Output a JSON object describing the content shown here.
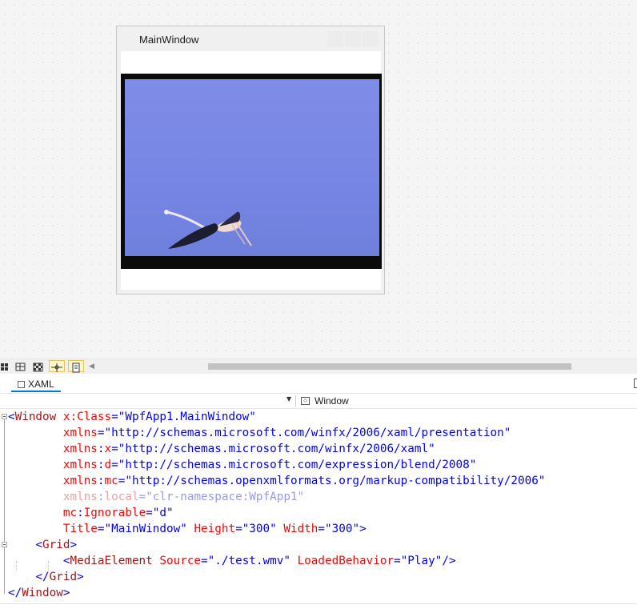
{
  "preview": {
    "window_title": "MainWindow"
  },
  "tabs": {
    "xaml_label": "XAML"
  },
  "nav": {
    "element_label": "Window"
  },
  "colors": {
    "xaml_tag": "#a31515",
    "xaml_attr": "#ff0000",
    "xaml_value": "#0000ff",
    "tab_accent": "#007acc"
  },
  "code": {
    "l1": {
      "lt": "<",
      "tag": "Window",
      "attr": "x:Class",
      "eq": "=",
      "val": "\"WpfApp1.MainWindow\""
    },
    "l2": {
      "attr": "xmlns",
      "eq": "=",
      "val": "\"http://schemas.microsoft.com/winfx/2006/xaml/presentation\""
    },
    "l3": {
      "ns": "xmlns",
      "colon": ":",
      "attr": "x",
      "eq": "=",
      "val": "\"http://schemas.microsoft.com/winfx/2006/xaml\""
    },
    "l4": {
      "ns": "xmlns",
      "colon": ":",
      "attr": "d",
      "eq": "=",
      "val": "\"http://schemas.microsoft.com/expression/blend/2008\""
    },
    "l5": {
      "ns": "xmlns",
      "colon": ":",
      "attr": "mc",
      "eq": "=",
      "val": "\"http://schemas.openxmlformats.org/markup-compatibility/2006\""
    },
    "l6": {
      "ns": "xmlns",
      "colon": ":",
      "attr": "local",
      "eq": "=",
      "val": "\"clr-namespace:WpfApp1\""
    },
    "l7": {
      "ns": "mc",
      "colon": ":",
      "attr": "Ignorable",
      "eq": "=",
      "val": "\"d\""
    },
    "l8": {
      "a1": "Title",
      "v1": "\"MainWindow\"",
      "a2": "Height",
      "v2": "\"300\"",
      "a3": "Width",
      "v3": "\"300\"",
      "eq": "=",
      "close": ">"
    },
    "l9": {
      "lt": "<",
      "tag": "Grid",
      "gt": ">"
    },
    "l10": {
      "lt": "<",
      "tag": "MediaElement",
      "a1": "Source",
      "v1": "\"./test.wmv\"",
      "a2": "LoadedBehavior",
      "v2": "\"Play\"",
      "eq": "=",
      "close": "/>"
    },
    "l11": {
      "lt": "</",
      "tag": "Grid",
      "gt": ">"
    },
    "l12": {
      "lt": "</",
      "tag": "Window",
      "gt": ">"
    }
  }
}
